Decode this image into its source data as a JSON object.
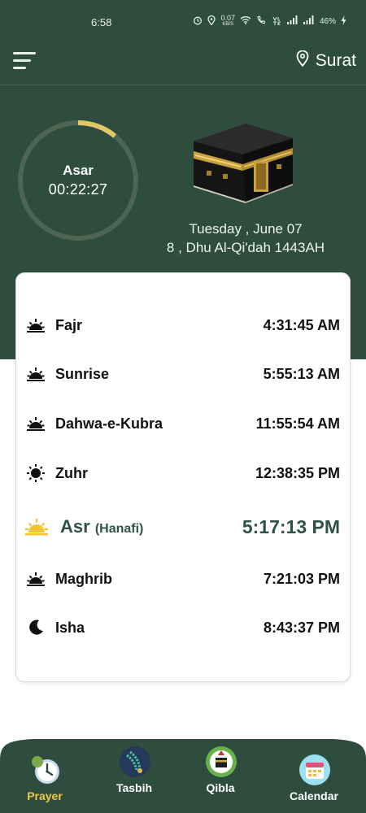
{
  "status_bar": {
    "time": "6:58",
    "speed": "0.07",
    "speed_unit": "KB/S",
    "battery": "46%"
  },
  "header": {
    "menu_icon": "hamburger-menu-icon",
    "location_icon": "map-pin-icon",
    "location": "Surat"
  },
  "countdown": {
    "prayer": "Asar",
    "remaining": "00:22:27",
    "progress": 0.11
  },
  "date": {
    "gregorian": "Tuesday , June 07",
    "hijri": "8 , Dhu Al-Qi'dah 1443AH"
  },
  "prayers": [
    {
      "name": "Fajr",
      "time": "4:31:45 AM",
      "icon": "sunrise-icon"
    },
    {
      "name": "Sunrise",
      "time": "5:55:13 AM",
      "icon": "sunrise-icon"
    },
    {
      "name": "Dahwa-e-Kubra",
      "time": "11:55:54 AM",
      "icon": "sunrise-icon"
    },
    {
      "name": "Zuhr",
      "time": "12:38:35 PM",
      "icon": "sun-icon"
    },
    {
      "name": "Asr",
      "sub": "(Hanafi)",
      "time": "5:17:13 PM",
      "icon": "sunset-icon",
      "active": true
    },
    {
      "name": "Maghrib",
      "time": "7:21:03 PM",
      "icon": "sunset-icon"
    },
    {
      "name": "Isha",
      "time": "8:43:37 PM",
      "icon": "moon-icon"
    }
  ],
  "bottom_nav": [
    {
      "label": "Prayer",
      "icon": "prayer-clock-icon",
      "active": true
    },
    {
      "label": "Tasbih",
      "icon": "tasbih-beads-icon"
    },
    {
      "label": "Qibla",
      "icon": "qibla-kaaba-icon"
    },
    {
      "label": "Calendar",
      "icon": "calendar-icon"
    }
  ],
  "colors": {
    "primary_green": "#2e4d3f",
    "accent_gold": "#e2c766",
    "active_text": "#2e5245",
    "nav_active": "#f2c84b"
  }
}
